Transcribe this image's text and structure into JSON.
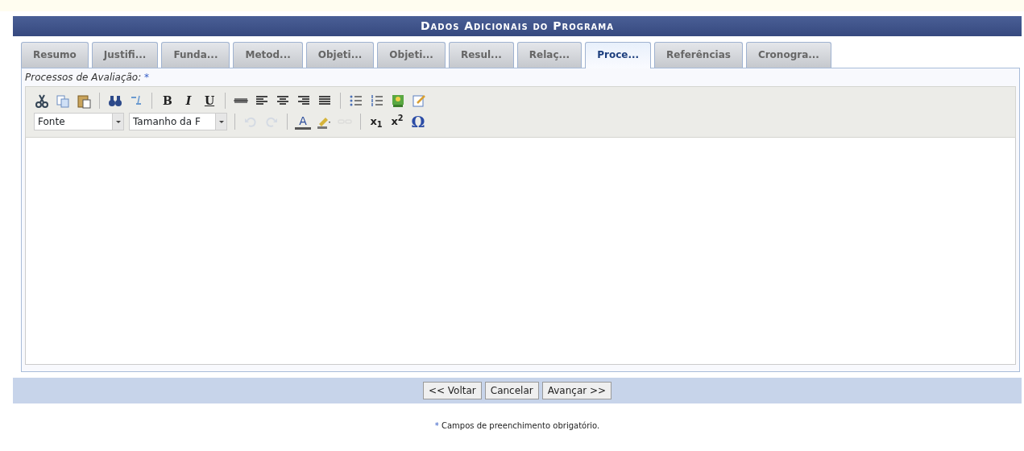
{
  "panel": {
    "title": "Dados Adicionais do Programa"
  },
  "tabs": [
    {
      "label": "Resumo",
      "selected": false
    },
    {
      "label": "Justifi...",
      "selected": false
    },
    {
      "label": "Funda...",
      "selected": false
    },
    {
      "label": "Metod...",
      "selected": false
    },
    {
      "label": "Objeti...",
      "selected": false
    },
    {
      "label": "Objeti...",
      "selected": false
    },
    {
      "label": "Resul...",
      "selected": false
    },
    {
      "label": "Relaç...",
      "selected": false
    },
    {
      "label": "Proce...",
      "selected": true
    },
    {
      "label": "Referências",
      "selected": false
    },
    {
      "label": "Cronogra...",
      "selected": false
    }
  ],
  "field": {
    "label": "Processos de Avaliação:",
    "required_mark": "*"
  },
  "toolbar_rows": [
    [
      {
        "kind": "icon"
      },
      {
        "kind": "icon"
      },
      {
        "kind": "icon"
      },
      {
        "kind": "separator"
      },
      {
        "kind": "icon"
      },
      {
        "kind": "icon"
      },
      {
        "kind": "separator"
      },
      {
        "kind": "glyph",
        "text": "B"
      },
      {
        "kind": "glyph",
        "text": "I"
      },
      {
        "kind": "glyph",
        "text": "U"
      },
      {
        "kind": "separator"
      },
      {
        "kind": "icon"
      },
      {
        "kind": "icon"
      },
      {
        "kind": "icon"
      },
      {
        "kind": "icon"
      },
      {
        "kind": "icon"
      },
      {
        "kind": "separator"
      },
      {
        "kind": "icon"
      },
      {
        "kind": "icon"
      },
      {
        "kind": "icon"
      },
      {
        "kind": "icon"
      }
    ],
    [
      {
        "kind": "select",
        "text": "Fonte"
      },
      {
        "kind": "select",
        "text": "Tamanho da F"
      },
      {
        "kind": "separator"
      },
      {
        "kind": "icon",
        "disabled": true
      },
      {
        "kind": "icon",
        "disabled": true
      },
      {
        "kind": "separator"
      },
      {
        "kind": "glyph",
        "text": "A"
      },
      {
        "kind": "icon"
      },
      {
        "kind": "icon",
        "disabled": true
      },
      {
        "kind": "separator"
      },
      {
        "kind": "glyph",
        "text": "x$_{1}$"
      },
      {
        "kind": "glyph",
        "text": "x$^{2}$"
      },
      {
        "kind": "glyph",
        "text": "Ω"
      }
    ]
  ],
  "buttons": [
    "<< Voltar",
    "Cancelar",
    "Avançar >>"
  ],
  "footnote": {
    "mark": "*",
    "text": "Campos de preenchimento obrigatório."
  }
}
